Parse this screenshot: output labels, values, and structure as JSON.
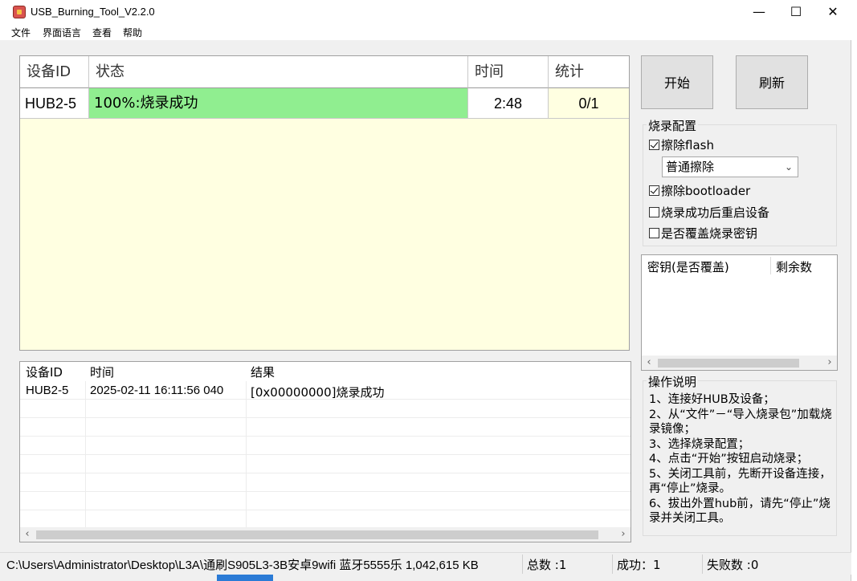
{
  "title": "USB_Burning_Tool_V2.2.0",
  "window_controls": {
    "minimize": "—",
    "maximize": "☐",
    "close": "✕"
  },
  "menu": [
    "文件",
    "界面语言",
    "查看",
    "帮助"
  ],
  "device_grid": {
    "headers": [
      "设备ID",
      "状态",
      "时间",
      "统计"
    ],
    "rows": [
      {
        "id": "HUB2-5",
        "status": "100%:烧录成功",
        "time": "2:48",
        "count": "0/1"
      }
    ]
  },
  "log": {
    "headers": [
      "设备ID",
      "时间",
      "结果"
    ],
    "rows": [
      {
        "id": "HUB2-5",
        "time": "2025-02-11 16:11:56 040",
        "result": "[0x00000000]烧录成功"
      }
    ]
  },
  "buttons": {
    "start": "开始",
    "refresh": "刷新"
  },
  "config": {
    "title": "烧录配置",
    "erase_flash": {
      "label": "擦除flash",
      "checked": true
    },
    "erase_mode": "普通擦除",
    "erase_bootloader": {
      "label": "擦除bootloader",
      "checked": true
    },
    "reboot_after": {
      "label": "烧录成功后重启设备",
      "checked": false
    },
    "overwrite_key": {
      "label": "是否覆盖烧录密钥",
      "checked": false
    }
  },
  "key_list": {
    "headers": [
      "密钥(是否覆盖)",
      "剩余数"
    ]
  },
  "instructions": {
    "title": "操作说明",
    "text": "1、连接好HUB及设备；\n2、从“文件”－“导入烧录包”加载烧录镜像；\n3、选择烧录配置；\n4、点击“开始”按钮启动烧录；\n5、关闭工具前，先断开设备连接，再“停止”烧录。\n6、拔出外置hub前，请先“停止”烧录并关闭工具。"
  },
  "status_bar": {
    "path": "C:\\Users\\Administrator\\Desktop\\L3A\\通刷S905L3-3B安卓9wifi 蓝牙5555乐 1,042,615 KB",
    "total": "总数 :1",
    "success": "成功：1",
    "fail": "失败数 :0"
  },
  "colors": {
    "success_cell": "#90ee90",
    "grid_bg": "#ffffe1"
  }
}
